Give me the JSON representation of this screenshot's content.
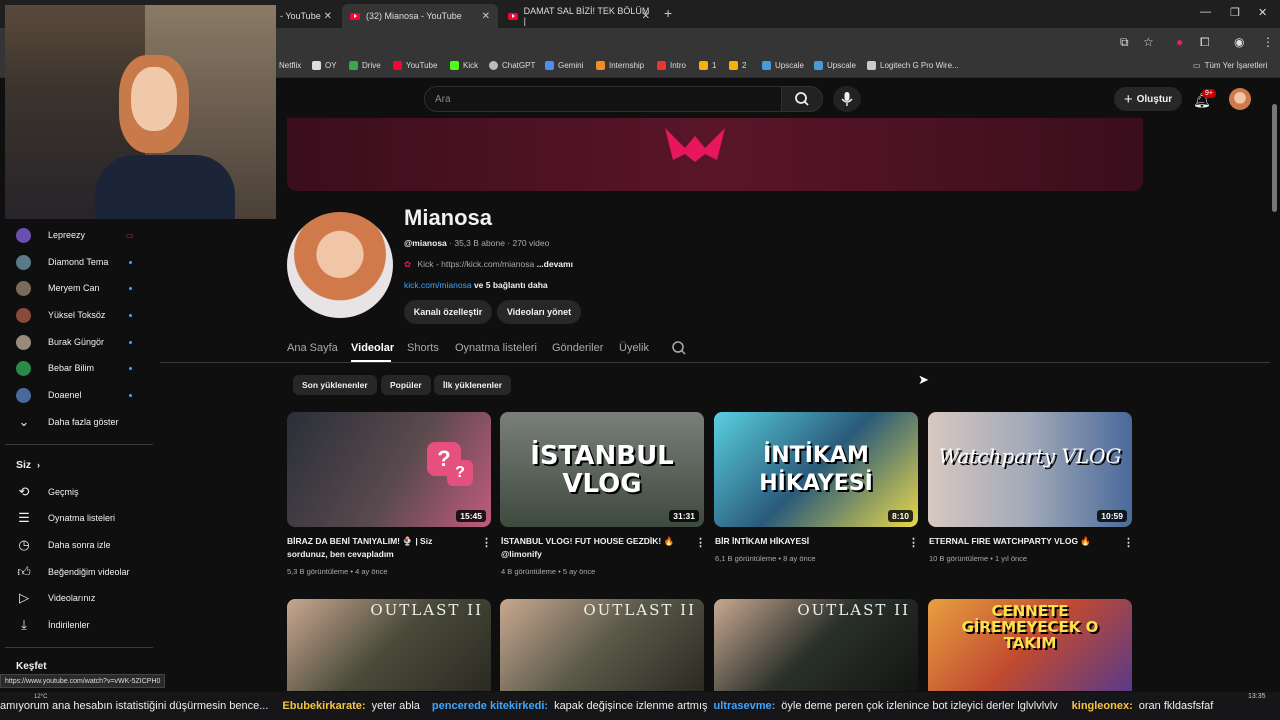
{
  "browser": {
    "tabs": [
      {
        "title": "- YouTube",
        "active": false
      },
      {
        "title": "(32) Mianosa - YouTube",
        "active": true
      },
      {
        "title": "DAMAT SAL BİZİ! TEK BÖLÜM |",
        "active": false
      }
    ],
    "bookmarks": [
      "Netflix",
      "OY",
      "Drive",
      "YouTube",
      "Kick",
      "ChatGPT",
      "Gemini",
      "Internship",
      "Intro",
      "1",
      "2",
      "Upscale",
      "Upscale",
      "Logitech G Pro Wire..."
    ],
    "all_bookmarks": "Tüm Yer İşaretleri"
  },
  "youtube": {
    "search_placeholder": "Ara",
    "create_label": "Oluştur",
    "notif_badge": "9+"
  },
  "channel": {
    "name": "Mianosa",
    "handle": "@mianosa",
    "stats": "· 35,3 B abone · 270 video",
    "kick": "Kick",
    "link_text": "- https://kick.com/mianosa",
    "more": "...devamı",
    "link_short": "kick.com/mianosa",
    "more_links": "ve 5 bağlantı daha",
    "customize_btn": "Kanalı özelleştir",
    "manage_btn": "Videoları yönet",
    "tabs": [
      "Ana Sayfa",
      "Videolar",
      "Shorts",
      "Oynatma listeleri",
      "Gönderiler",
      "Üyelik"
    ],
    "chips": [
      "Son yüklenenler",
      "Popüler",
      "İlk yüklenenler"
    ]
  },
  "videos": [
    {
      "thumb_text": "",
      "duration": "15:45",
      "title1": "BİRAZ DA BENİ TANIYALIM! 🍨 | Siz",
      "title2": "sordunuz, ben cevapladım",
      "meta": "5,3 B görüntüleme • 4 ay önce"
    },
    {
      "thumb_text": "İSTANBUL VLOG",
      "duration": "31:31",
      "title1": "İSTANBUL VLOG! FUT HOUSE GEZDİK! 🔥",
      "title2": "@limonify",
      "meta": "4 B görüntüleme • 5 ay önce"
    },
    {
      "thumb_text": "İNTİKAM HİKAYESİ",
      "duration": "8:10",
      "title1": "BİR İNTİKAM HİKAYESİ",
      "title2": "",
      "meta": "6,1 B görüntüleme • 8 ay önce"
    },
    {
      "thumb_text": "Watchparty VLOG",
      "duration": "10:59",
      "title1": "ETERNAL FIRE WATCHPARTY VLOG 🔥",
      "title2": "",
      "meta": "10 B görüntüleme • 1 yıl önce"
    }
  ],
  "row2": [
    {
      "label": "OUTLAST II"
    },
    {
      "label": "OUTLAST II"
    },
    {
      "label": "OUTLAST II"
    },
    {
      "label": "CENNETE GİREMEYECEK O TAKIM"
    }
  ],
  "sidebar": {
    "subs": [
      {
        "name": "Lepreezy",
        "color": "#6b4fb0",
        "dot": "#e0245e"
      },
      {
        "name": "Diamond Tema",
        "color": "#5a7a8a",
        "dot": "#3ea6ff"
      },
      {
        "name": "Meryem Can",
        "color": "#7a6a5a",
        "dot": "#3ea6ff"
      },
      {
        "name": "Yüksel Toksöz",
        "color": "#8a4a3a",
        "dot": "#3ea6ff"
      },
      {
        "name": "Burak Güngör",
        "color": "#9a8a7a",
        "dot": "#3ea6ff"
      },
      {
        "name": "Bebar Bilim",
        "color": "#2a8a4a",
        "dot": "#3ea6ff"
      },
      {
        "name": "Doaenel",
        "color": "#4a6a9a",
        "dot": "#3ea6ff"
      }
    ],
    "show_more": "Daha fazla göster",
    "you_title": "Siz",
    "you_items": [
      "Geçmiş",
      "Oynatma listeleri",
      "Daha sonra izle",
      "Beğendiğim videolar",
      "Videolarınız",
      "İndirilenler"
    ],
    "explore_title": "Keşfet"
  },
  "status_url": "https://www.youtube.com/watch?v=vWK-5ZICPH0",
  "taskbar": {
    "temp": "12°C",
    "time": "13:35"
  },
  "ticker": [
    {
      "user": "",
      "msg": "amıyorum ana hesabın istatistiğini düşürmesin bence..."
    },
    {
      "user": "Ebubekirkarate:",
      "msg": "yeter abla"
    },
    {
      "user": "pencerede kitekirkedi:",
      "msg": "kapak değişince izlenme artmış"
    },
    {
      "user": "ultrasevme:",
      "msg": "öyle deme peren çok izlenince bot izleyici derler lglvlvlvlv"
    },
    {
      "user": "kingleonex:",
      "msg": "oran fkldasfsfaf"
    }
  ]
}
